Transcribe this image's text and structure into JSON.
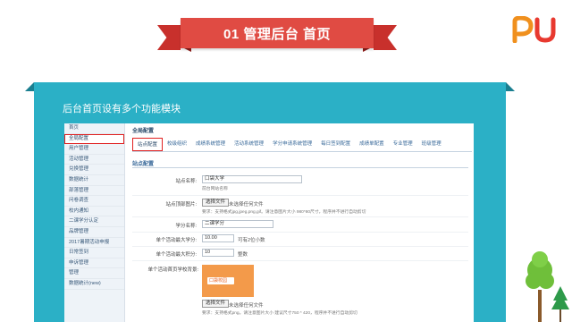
{
  "banner": {
    "title": "01 管理后台 首页"
  },
  "logo": {
    "text": "PU"
  },
  "frame": {
    "title": "后台首页设有多个功能模块"
  },
  "sidebar": {
    "items": [
      {
        "label": "首页",
        "active": false
      },
      {
        "label": "全局配置",
        "active": true
      },
      {
        "label": "用户管理",
        "active": false
      },
      {
        "label": "活动管理",
        "active": false
      },
      {
        "label": "兑换管理",
        "active": false
      },
      {
        "label": "数据统计",
        "active": false
      },
      {
        "label": "部落管理",
        "active": false
      },
      {
        "label": "问卷调查",
        "active": false
      },
      {
        "label": "校内通知",
        "active": false
      },
      {
        "label": "二课学分认定",
        "active": false
      },
      {
        "label": "品牌管理",
        "active": false
      },
      {
        "label": "2017暑期活动申报",
        "active": false
      },
      {
        "label": "日常签到",
        "active": false
      },
      {
        "label": "申诉管理",
        "active": false
      },
      {
        "label": "管理",
        "active": false
      },
      {
        "label": "数据统计(new)",
        "active": false
      }
    ]
  },
  "main": {
    "title": "全局配置",
    "tabs": [
      {
        "label": "站点配置",
        "active": true
      },
      {
        "label": "校级组织",
        "active": false
      },
      {
        "label": "成绩系统管理",
        "active": false
      },
      {
        "label": "活动系统管理",
        "active": false
      },
      {
        "label": "学分申请系统管理",
        "active": false
      },
      {
        "label": "每日签到配置",
        "active": false
      },
      {
        "label": "成绩单配置",
        "active": false
      },
      {
        "label": "专业管理",
        "active": false
      },
      {
        "label": "班级管理",
        "active": false
      }
    ],
    "section_title": "站点配置",
    "form": {
      "site_name_label": "站点名称:",
      "site_name_value": "口袋大学",
      "site_name_hint": "前台网站名称",
      "top_image_label": "站点顶部图片:",
      "choose_file_label": "选择文件",
      "no_file_label": "未选择任何文件",
      "top_image_hint": "要求：支持格式jpg,jpeg,png,gif。请注意图片大小 980*80尺寸，程序并不进行自动剪切",
      "credit_name_label": "学分名称:",
      "credit_name_value": "二课学分",
      "max_credit_label": "单个活动最大学分:",
      "max_credit_value": "10.00",
      "max_credit_note": "可有2位小数",
      "max_points_label": "单个活动最大积分:",
      "max_points_value": "10",
      "max_points_note": "整数",
      "bg_image_label": "单个活动首页学校背景:",
      "bg_image_hint": "要求：支持格式png。请注意图片大小 建议尺寸750 * 420，程序并不进行自动剪切",
      "poster_text": "口袋校园"
    }
  },
  "colors": {
    "banner_red": "#e04b43",
    "frame_teal": "#2bb0c6",
    "highlight_red": "#e02020",
    "poster_orange": "#f39a4a",
    "logo_orange": "#f0901e",
    "logo_red": "#e8392f",
    "tree_green": "#6fbf3a",
    "tree_dark_green": "#2e9a4a"
  }
}
